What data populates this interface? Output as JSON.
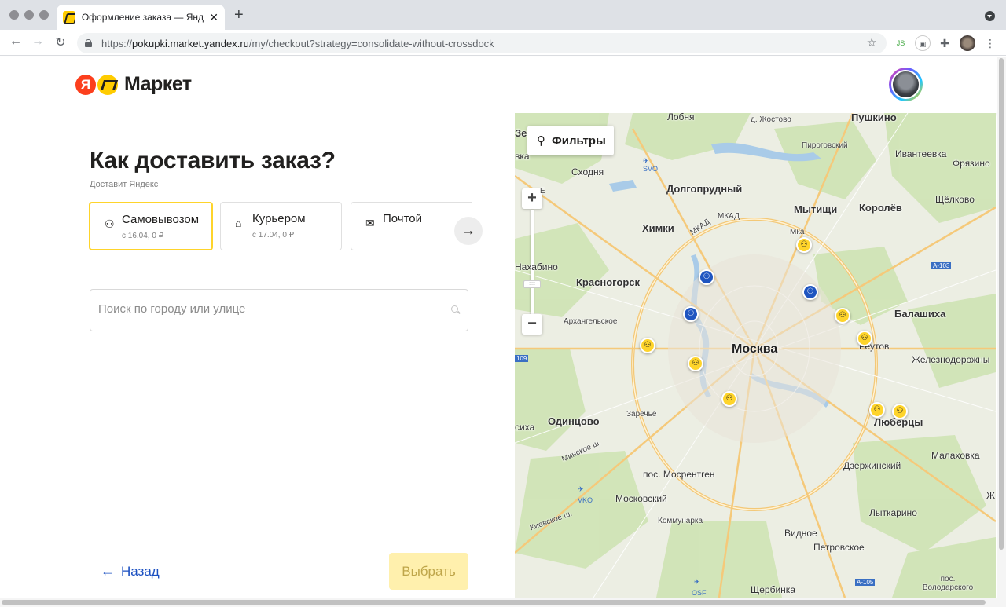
{
  "browser": {
    "tab_title": "Оформление заказа — Яндекс",
    "tab_close": "✕",
    "new_tab": "+",
    "url_prefix": "https://",
    "url_domain": "pokupki.market.yandex.ru",
    "url_path": "/my/checkout?strategy=consolidate-without-crossdock",
    "ext_js": "JS"
  },
  "header": {
    "logo_ya": "Я",
    "logo_word": "Маркет"
  },
  "checkout": {
    "title": "Как доставить заказ?",
    "delivered_by": "Доставит Яндекс",
    "options": [
      {
        "label": "Самовывозом",
        "sub": "с 16.04, 0 ₽",
        "icon": "pickup-icon"
      },
      {
        "label": "Курьером",
        "sub": "с 17.04, 0 ₽",
        "icon": "house-icon"
      },
      {
        "label": "Почтой",
        "sub": "",
        "icon": "mailbox-icon"
      }
    ],
    "search_placeholder": "Поиск по городу или улице",
    "back_label": "Назад",
    "choose_label": "Выбрать"
  },
  "map": {
    "filters_label": "Фильтры",
    "zoom_in": "+",
    "zoom_out": "−",
    "zoom_handle": "::::",
    "labels": {
      "lobnya": "Лобня",
      "zhostovo": "д. Жостово",
      "pushkino": "Пушкино",
      "ze": "Зе",
      "vka": "вка",
      "skhodnya": "Сходня",
      "svo": "SVO",
      "pirogovsky": "Пироговский",
      "ivanteevka": "Ивантеевка",
      "fryazino": "Фрязино",
      "e": "Е",
      "dolgoprudny": "Долгопрудный",
      "mytishchi": "Мытищи",
      "korolev": "Королёв",
      "shchelkovo": "Щёлково",
      "khimki": "Химки",
      "mkad1": "МКАД",
      "mkad2": "МКАД",
      "mka": "Мка",
      "a103": "А-103",
      "nakhabino": "Нахабино",
      "krasnogorsk": "Красногорск",
      "arkhangelskoe": "Архангельское",
      "balashikha": "Балашиха",
      "moskva": "Москва",
      "reutov": "Реутов",
      "zheleznodorozhny": "Железнодорожны",
      "r109": "109",
      "zarechye": "Заречье",
      "sikha": "сиха",
      "odintsovo": "Одинцово",
      "lyubertsy": "Люберцы",
      "minskoe": "Минское ш.",
      "malakhovka": "Малаховка",
      "dzerzhinsky": "Дзержинский",
      "mosrentgen": "пос. Мосрентген",
      "vko": "VKO",
      "moskovsky": "Московский",
      "zh": "Ж",
      "kommunarka": "Коммунарка",
      "lytkarino": "Лыткарино",
      "kievskoe": "Киевское ш.",
      "vidnoe": "Видное",
      "petrovskoe": "Петровское",
      "a105": "А-105",
      "volodarskogo": "пос. Володарского",
      "osf": "OSF",
      "shcherbinka": "Щербинка"
    },
    "pin_glyph": "⚇"
  },
  "colors": {
    "accent_yellow": "#fed42b",
    "link_blue": "#1a4fc1",
    "pin_blue": "#1f55c0",
    "logo_red": "#fc3f1d"
  }
}
